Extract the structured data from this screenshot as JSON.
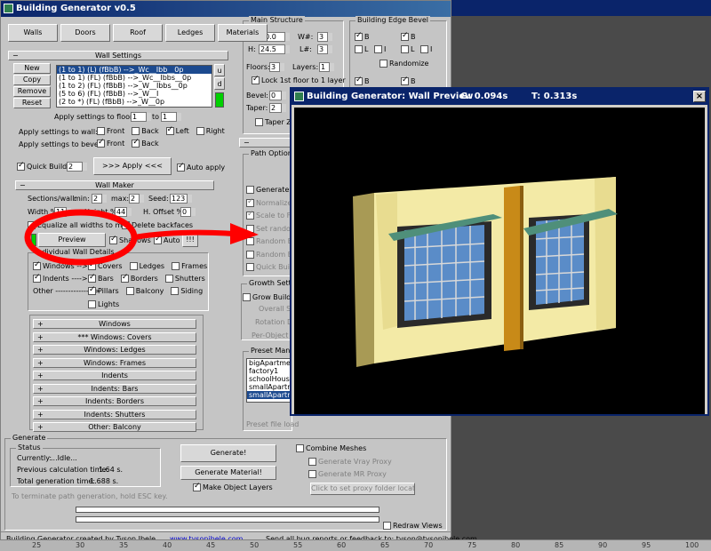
{
  "window": {
    "title": "Building Generator v0.5"
  },
  "tabs": [
    "Walls",
    "Doors",
    "Roof",
    "Ledges",
    "Materials"
  ],
  "wall_settings": {
    "title": "Wall Settings",
    "buttons": [
      "New",
      "Copy",
      "Remove",
      "Reset"
    ],
    "side_buttons": [
      "u",
      "d"
    ],
    "list": [
      "(1 to 1) (L) (fBbB) -->_Wc__Ibb__0p",
      "(1 to 1) (FL) (fBbB) -->_Wc__Ibbs__0p",
      "(1 to 2) (FL) (fBbB) -->_W__Ibbs__0p",
      "(5 to 6) (FL) (fBbB) -->_W__I",
      "(2 to *) (FL) (fBbB) -->_W__0p"
    ],
    "apply_floor_label": "Apply settings to floor(s):",
    "floor_from": "1",
    "floor_to_label": "to",
    "floor_to": "1",
    "apply_wall_label": "Apply settings to wall:",
    "wall_opts": [
      {
        "label": "Front",
        "on": false
      },
      {
        "label": "Back",
        "on": false
      },
      {
        "label": "Left",
        "on": true
      },
      {
        "label": "Right",
        "on": false
      }
    ],
    "apply_bevel_label": "Apply settings to bevel:",
    "bevel_opts": [
      {
        "label": "Front",
        "on": true
      },
      {
        "label": "Back",
        "on": true
      }
    ],
    "quick_build_label": "Quick Build",
    "quick_build_value": "2",
    "apply_button": ">>> Apply <<<",
    "auto_apply_label": "Auto apply"
  },
  "wall_maker": {
    "title": "Wall Maker",
    "sections_label": "Sections/wall:",
    "min_label": "min:",
    "min": "2",
    "max_label": "max:",
    "max": "2",
    "seed_label": "Seed:",
    "seed": "123",
    "width_label": "Width %",
    "width": "11",
    "height_label": "Height %",
    "height": "44",
    "hoffset_label": "H. Offset %",
    "hoffset": "0",
    "equalize_label": "Equalize all widths to max",
    "delete_label": "Delete backfaces",
    "preview_button": "Preview",
    "shadows_label": "Shadows",
    "auto_label": "Auto",
    "excl": "!!!"
  },
  "details": {
    "title": "Individual Wall Details",
    "windows_label": "Windows -->",
    "indents_label": "Indents ---->",
    "other_label": "Other --------------->",
    "items_row1": [
      {
        "label": "Covers",
        "on": true
      },
      {
        "label": "Ledges",
        "on": false
      },
      {
        "label": "Frames",
        "on": false
      }
    ],
    "items_row2": [
      {
        "label": "Bars",
        "on": true
      },
      {
        "label": "Borders",
        "on": true
      },
      {
        "label": "Shutters",
        "on": false
      }
    ],
    "items_row3": [
      {
        "label": "Pillars",
        "on": true
      },
      {
        "label": "Balcony",
        "on": false
      },
      {
        "label": "Siding",
        "on": false
      }
    ],
    "lights_label": "Lights"
  },
  "rollouts": [
    "Windows",
    "*** Windows: Covers",
    "Windows: Ledges",
    "Windows: Frames",
    "Indents",
    "Indents: Bars",
    "Indents: Borders",
    "Indents: Shutters",
    "Other: Balcony"
  ],
  "main_structure": {
    "title": "Main Structure",
    "L_label": "L:",
    "L": "40.0",
    "H_label": "H:",
    "H": "24.5",
    "Wnum_label": "W#:",
    "Wnum": "3",
    "Lnum_label": "L#:",
    "Lnum": "3",
    "floors_label": "Floors:",
    "floors": "3",
    "layers_label": "Layers:",
    "layers": "1",
    "lock_label": "Lock 1st floor to 1 layer",
    "bevel_label": "Bevel:",
    "bevel": "0",
    "taper_label": "Taper:",
    "taper": "2",
    "taperz_label": "Taper Z"
  },
  "edge_bevel": {
    "title": "Building Edge Bevel",
    "B": "B",
    "L": "L",
    "I": "I",
    "randomize_label": "Randomize"
  },
  "path_options": {
    "title": "Path Options",
    "items": [
      "Generate A",
      "Normalize",
      "Scale to F",
      "Set random",
      "Random B",
      "Random B",
      "Quick Buil"
    ]
  },
  "growth": {
    "title": "Growth Settings",
    "grow_label": "Grow Buildin",
    "items": [
      "Overall Sp",
      "Rotation D",
      "Per-Object D"
    ]
  },
  "presets": {
    "title": "Preset Manage",
    "items": [
      "bigApartment1",
      "factory1",
      "schoolHouse",
      "smallApartmen",
      "smallApartmen"
    ],
    "selected": 4,
    "file_label": "Preset file load"
  },
  "generate": {
    "title": "Generate",
    "status_title": "Status",
    "currently_label": "Currently:",
    "currently": "...Idle...",
    "prev_calc_label": "Previous calculation time:",
    "prev_calc": "1.64 s.",
    "total_gen_label": "Total generation time:",
    "total_gen": "1.688 s.",
    "terminate_note": "To terminate path generation, hold ESC key.",
    "generate_button": "Generate!",
    "material_button": "Generate Material!",
    "make_layers_label": "Make Object Layers",
    "combine_label": "Combine Meshes",
    "vray_label": "Generate Vray Proxy",
    "mr_label": "Generate MR Proxy",
    "proxy_button": "Click to set proxy folder location",
    "redraw_label": "Redraw Views"
  },
  "footer": {
    "credit": "Building Generator created by Tyson Ibele",
    "url": "www.tysonibele.com",
    "bugs": "Send all bug reports or feedback to: tyson@tysonibele.com"
  },
  "preview_window": {
    "title": "Building Generator: Wall Preview",
    "g_time": "G: 0.094s",
    "t_time": "T: 0.313s",
    "close": "×"
  },
  "ruler": [
    "25",
    "30",
    "35",
    "40",
    "45",
    "50",
    "55",
    "60",
    "65",
    "70",
    "75",
    "80",
    "85",
    "90",
    "95",
    "100"
  ],
  "colors": {
    "wall": "#f3eaa6",
    "pillar": "#c88a18",
    "glass": "#5a8cc8",
    "awning": "#4f8f7a",
    "annotation": "#ff0000"
  }
}
